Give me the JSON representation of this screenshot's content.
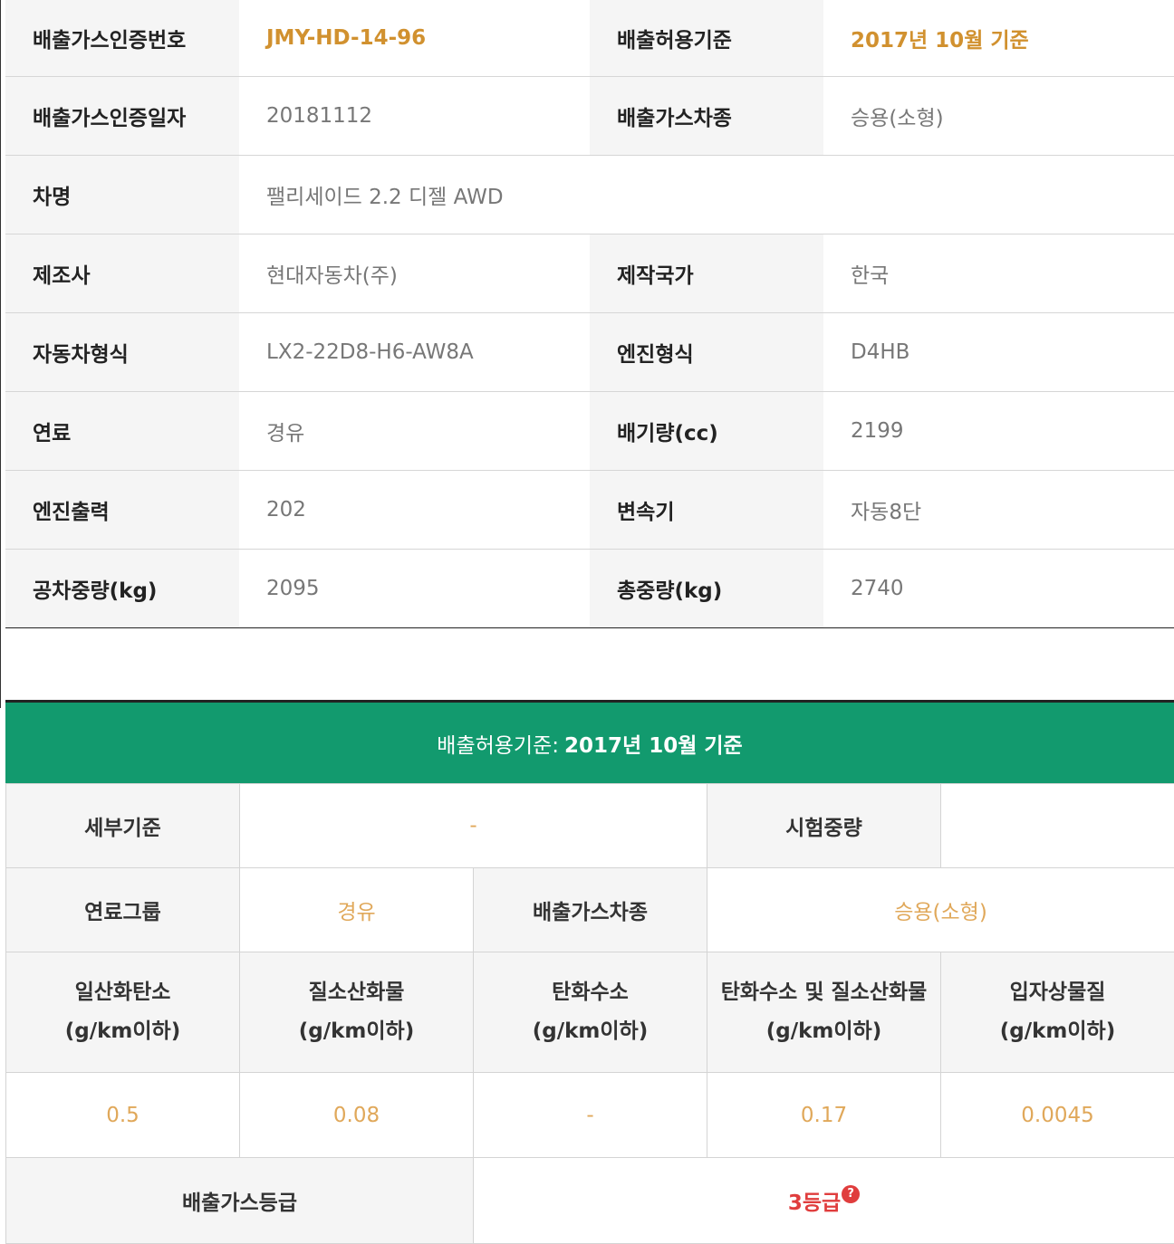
{
  "spec": {
    "rows": [
      [
        {
          "label": "배출가스인증번호",
          "value": "JMY-HD-14-96"
        },
        {
          "label": "배출허용기준",
          "value": "2017년 10월 기준"
        }
      ],
      [
        {
          "label": "배출가스인증일자",
          "value": "20181112"
        },
        {
          "label": "배출가스차종",
          "value": "승용(소형)"
        }
      ],
      [
        {
          "label": "차명",
          "value": "팰리세이드 2.2 디젤 AWD"
        }
      ],
      [
        {
          "label": "제조사",
          "value": "현대자동차(주)"
        },
        {
          "label": "제작국가",
          "value": "한국"
        }
      ],
      [
        {
          "label": "자동차형식",
          "value": "LX2-22D8-H6-AW8A"
        },
        {
          "label": "엔진형식",
          "value": "D4HB"
        }
      ],
      [
        {
          "label": "연료",
          "value": "경유"
        },
        {
          "label": "배기량(cc)",
          "value": "2199"
        }
      ],
      [
        {
          "label": "엔진출력",
          "value": "202"
        },
        {
          "label": "변속기",
          "value": "자동8단"
        }
      ],
      [
        {
          "label": "공차중량(kg)",
          "value": "2095"
        },
        {
          "label": "총중량(kg)",
          "value": "2740"
        }
      ]
    ]
  },
  "emission": {
    "header_prefix": "배출허용기준:",
    "header_value": "2017년 10월 기준",
    "detail_label": "세부기준",
    "detail_value": "-",
    "test_weight_label": "시험중량",
    "test_weight_value": "",
    "fuel_group_label": "연료그룹",
    "fuel_group_value": "경유",
    "vehicle_type_label": "배출가스차종",
    "vehicle_type_value": "승용(소형)",
    "pollutants": [
      {
        "name": "일산화탄소",
        "unit": "(g/km이하)",
        "value": "0.5"
      },
      {
        "name": "질소산화물",
        "unit": "(g/km이하)",
        "value": "0.08"
      },
      {
        "name": "탄화수소",
        "unit": "(g/km이하)",
        "value": "-"
      },
      {
        "name": "탄화수소 및 질소산화물",
        "unit": "(g/km이하)",
        "value": "0.17"
      },
      {
        "name": "입자상물질",
        "unit": "(g/km이하)",
        "value": "0.0045"
      }
    ],
    "grade_label": "배출가스등급",
    "grade_value": "3등급",
    "grade_help": "?"
  },
  "colors": {
    "accent_orange": "#d1912f",
    "header_green": "#129a6e",
    "value_orange": "#e0a85a",
    "grade_red": "#e03d3d"
  }
}
